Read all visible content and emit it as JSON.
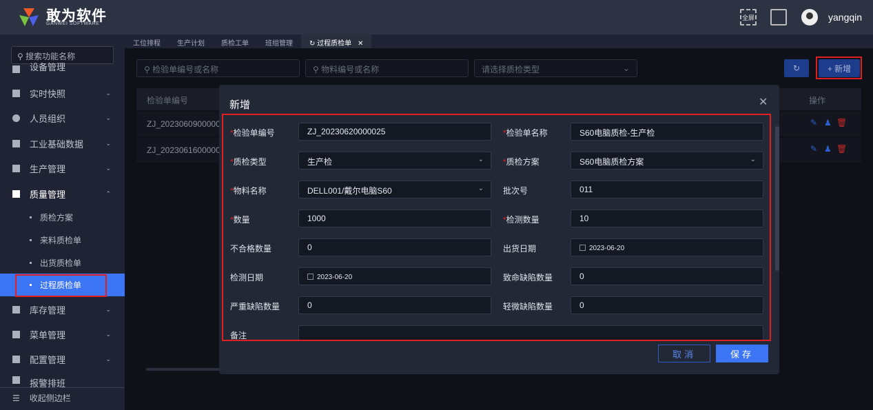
{
  "brand": {
    "name": "敢为软件",
    "sub": "GANWEI SOFTWARE"
  },
  "header": {
    "fullscreen_label": "全屏",
    "username": "yangqin"
  },
  "sidebar": {
    "search_placeholder": "搜索功能名称",
    "items": [
      {
        "label": "设备管理",
        "top_partial": true
      },
      {
        "label": "实时快照"
      },
      {
        "label": "人员组织"
      },
      {
        "label": "工业基础数据"
      },
      {
        "label": "生产管理"
      },
      {
        "label": "质量管理",
        "expanded": true
      },
      {
        "label": "库存管理"
      },
      {
        "label": "菜单管理"
      },
      {
        "label": "配置管理"
      },
      {
        "label": "报警排班"
      }
    ],
    "subitems": [
      {
        "label": "质检方案"
      },
      {
        "label": "来料质检单"
      },
      {
        "label": "出货质检单"
      },
      {
        "label": "过程质检单",
        "active": true
      }
    ],
    "collapse_label": "收起侧边栏"
  },
  "tabs": [
    {
      "label": "工位排程"
    },
    {
      "label": "生产计划"
    },
    {
      "label": "质检工单"
    },
    {
      "label": "班组管理"
    },
    {
      "label": "过程质检单",
      "active": true
    }
  ],
  "filters": {
    "code_placeholder": "检验单编号或名称",
    "material_placeholder": "物料编号或名称",
    "type_placeholder": "请选择质检类型",
    "add_label": "+ 新增"
  },
  "table": {
    "headers": [
      "检验单编号",
      "操作"
    ],
    "rows": [
      {
        "code": "ZJ_2023060900000"
      },
      {
        "code": "ZJ_2023061600000"
      }
    ]
  },
  "modal": {
    "title": "新增",
    "cancel": "取消",
    "save": "保存",
    "fields": [
      {
        "label": "检验单编号",
        "required": true,
        "value": "ZJ_20230620000025"
      },
      {
        "label": "检验单名称",
        "required": true,
        "value": "S60电脑质检-生产检"
      },
      {
        "label": "质检类型",
        "required": true,
        "value": "生产检",
        "select": true
      },
      {
        "label": "质检方案",
        "required": true,
        "value": "S60电脑质检方案",
        "select": true
      },
      {
        "label": "物料名称",
        "required": true,
        "value": "DELL001/戴尔电脑S60",
        "select": true
      },
      {
        "label": "批次号",
        "value": "011"
      },
      {
        "label": "数量",
        "required": true,
        "value": "1000"
      },
      {
        "label": "检测数量",
        "required": true,
        "value": "10"
      },
      {
        "label": "不合格数量",
        "value": "0"
      },
      {
        "label": "出货日期",
        "value": "2023-06-20",
        "date": true
      },
      {
        "label": "检测日期",
        "value": "2023-06-20",
        "date": true
      },
      {
        "label": "致命缺陷数量",
        "value": "0"
      },
      {
        "label": "严重缺陷数量",
        "value": "0"
      },
      {
        "label": "轻微缺陷数量",
        "value": "0"
      },
      {
        "label": "备注",
        "value": ""
      }
    ]
  }
}
